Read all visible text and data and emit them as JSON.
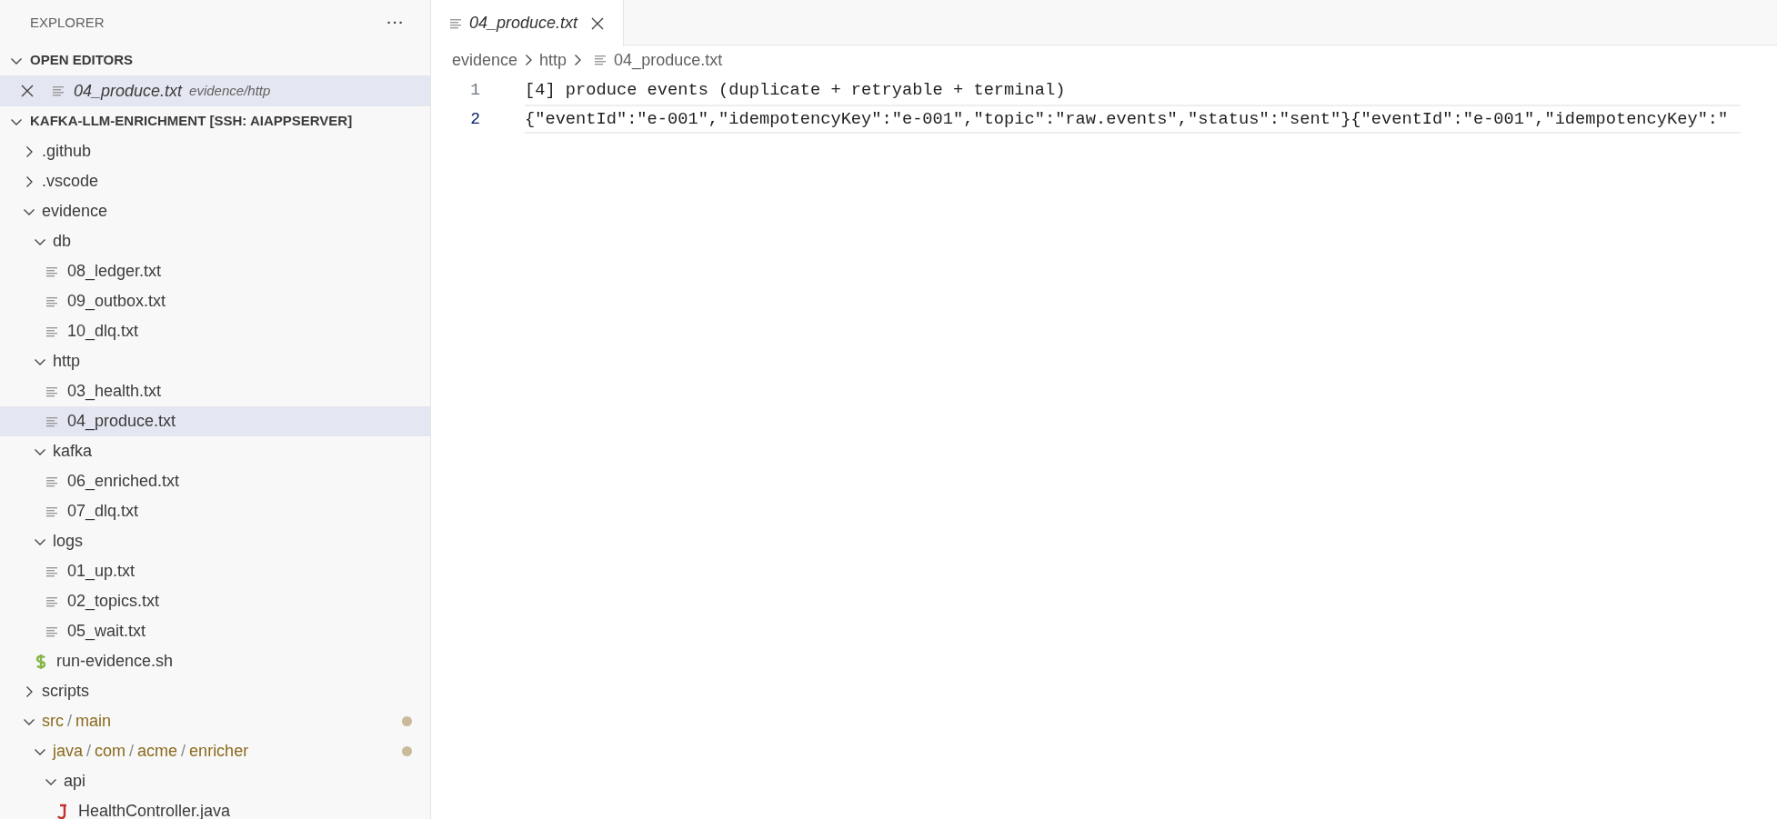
{
  "sidebar": {
    "title": "EXPLORER",
    "more": "···",
    "open_editors": {
      "label": "OPEN EDITORS",
      "expanded": true,
      "items": [
        {
          "name": "04_produce.txt",
          "path": "evidence/http",
          "selected": true
        }
      ]
    },
    "root": {
      "label": "KAFKA-LLM-ENRICHMENT [SSH: AIAPPSERVER]",
      "expanded": true,
      "children": [
        {
          "kind": "folder",
          "segments": [
            ".github"
          ],
          "expanded": false,
          "modified": false,
          "selected": false
        },
        {
          "kind": "folder",
          "segments": [
            ".vscode"
          ],
          "expanded": false,
          "modified": false,
          "selected": false
        },
        {
          "kind": "folder",
          "segments": [
            "evidence"
          ],
          "expanded": true,
          "modified": false,
          "selected": false,
          "children": [
            {
              "kind": "folder",
              "segments": [
                "db"
              ],
              "expanded": true,
              "modified": false,
              "selected": false,
              "children": [
                {
                  "kind": "text",
                  "segments": [
                    "08_ledger.txt"
                  ],
                  "selected": false
                },
                {
                  "kind": "text",
                  "segments": [
                    "09_outbox.txt"
                  ],
                  "selected": false
                },
                {
                  "kind": "text",
                  "segments": [
                    "10_dlq.txt"
                  ],
                  "selected": false
                }
              ]
            },
            {
              "kind": "folder",
              "segments": [
                "http"
              ],
              "expanded": true,
              "modified": false,
              "selected": false,
              "children": [
                {
                  "kind": "text",
                  "segments": [
                    "03_health.txt"
                  ],
                  "selected": false
                },
                {
                  "kind": "text",
                  "segments": [
                    "04_produce.txt"
                  ],
                  "selected": true
                }
              ]
            },
            {
              "kind": "folder",
              "segments": [
                "kafka"
              ],
              "expanded": true,
              "modified": false,
              "selected": false,
              "children": [
                {
                  "kind": "text",
                  "segments": [
                    "06_enriched.txt"
                  ],
                  "selected": false
                },
                {
                  "kind": "text",
                  "segments": [
                    "07_dlq.txt"
                  ],
                  "selected": false
                }
              ]
            },
            {
              "kind": "folder",
              "segments": [
                "logs"
              ],
              "expanded": true,
              "modified": false,
              "selected": false,
              "children": [
                {
                  "kind": "text",
                  "segments": [
                    "01_up.txt"
                  ],
                  "selected": false
                },
                {
                  "kind": "text",
                  "segments": [
                    "02_topics.txt"
                  ],
                  "selected": false
                },
                {
                  "kind": "text",
                  "segments": [
                    "05_wait.txt"
                  ],
                  "selected": false
                }
              ]
            },
            {
              "kind": "shell",
              "segments": [
                "run-evidence.sh"
              ],
              "selected": false
            }
          ]
        },
        {
          "kind": "folder",
          "segments": [
            "scripts"
          ],
          "expanded": false,
          "modified": false,
          "selected": false
        },
        {
          "kind": "folder",
          "segments": [
            "src",
            "main"
          ],
          "separator": "/",
          "expanded": true,
          "modified": true,
          "selected": false,
          "children": [
            {
              "kind": "folder",
              "segments": [
                "java",
                "com",
                "acme",
                "enricher"
              ],
              "separator": "/",
              "expanded": true,
              "modified": true,
              "selected": false,
              "children": [
                {
                  "kind": "folder",
                  "segments": [
                    "api"
                  ],
                  "expanded": true,
                  "modified": false,
                  "selected": false,
                  "children": [
                    {
                      "kind": "java",
                      "segments": [
                        "HealthController.java"
                      ],
                      "selected": false
                    }
                  ]
                }
              ]
            }
          ]
        }
      ]
    }
  },
  "editor": {
    "tabs": [
      {
        "name": "04_produce.txt",
        "selected": true
      }
    ],
    "breadcrumbs": [
      "evidence",
      "http",
      "04_produce.txt"
    ],
    "lines": [
      {
        "number": "1",
        "text": "[4] produce events (duplicate + retryable + terminal)",
        "current": false
      },
      {
        "number": "2",
        "text": "{\"eventId\":\"e-001\",\"idempotencyKey\":\"e-001\",\"topic\":\"raw.events\",\"status\":\"sent\"}{\"eventId\":\"e-001\",\"idempotencyKey\":\"",
        "current": true
      }
    ]
  }
}
